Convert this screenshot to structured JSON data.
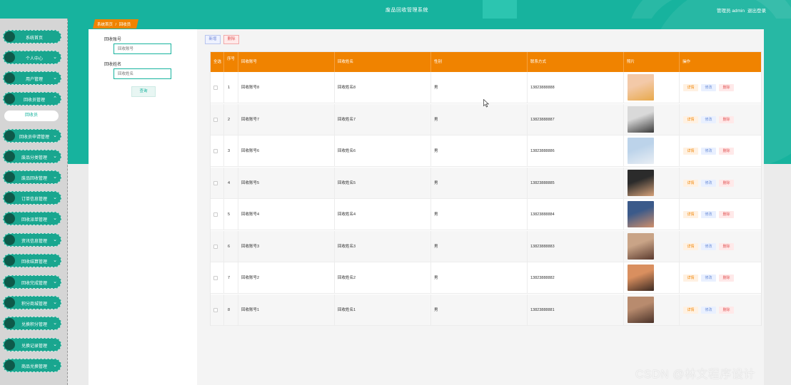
{
  "header": {
    "title": "废品回收管理系统",
    "admin_label": "管理员 admin",
    "logout_label": "退出登录"
  },
  "sidebar": {
    "items": [
      {
        "label": "系统首页",
        "expandable": false
      },
      {
        "label": "个人中心",
        "expandable": true
      },
      {
        "label": "用户管理",
        "expandable": true
      },
      {
        "label": "回收员管理",
        "expandable": true,
        "expanded": true
      },
      {
        "label": "回收员申请管理",
        "expandable": true
      },
      {
        "label": "废品分类管理",
        "expandable": true
      },
      {
        "label": "废品回收管理",
        "expandable": true
      },
      {
        "label": "订单信息管理",
        "expandable": true
      },
      {
        "label": "回收派单管理",
        "expandable": true
      },
      {
        "label": "资讯信息管理",
        "expandable": true
      },
      {
        "label": "回收结算管理",
        "expandable": true
      },
      {
        "label": "回收完成管理",
        "expandable": true
      },
      {
        "label": "积分商城管理",
        "expandable": true
      },
      {
        "label": "兑换积分管理",
        "expandable": true
      },
      {
        "label": "兑换记录管理",
        "expandable": true
      },
      {
        "label": "商品兑换管理",
        "expandable": true
      }
    ],
    "active_sub": "回收员"
  },
  "breadcrumb": {
    "home": "系统首页",
    "sep": "/",
    "current": "回收员"
  },
  "search": {
    "account_label": "回收账号",
    "account_placeholder": "回收账号",
    "name_label": "回收姓名",
    "name_placeholder": "回收姓名",
    "button_label": "查询"
  },
  "toolbar": {
    "add_label": "新增",
    "delete_label": "删除"
  },
  "table": {
    "headers": {
      "select": "全选",
      "index": "序号",
      "account": "回收账号",
      "name": "回收姓名",
      "gender": "性别",
      "phone": "联系方式",
      "photo": "照片",
      "actions": "操作"
    },
    "action_labels": {
      "detail": "详情",
      "edit": "修改",
      "remove": "删除"
    },
    "rows": [
      {
        "index": "1",
        "account": "回收账号8",
        "name": "回收姓名8",
        "gender": "男",
        "phone": "13823888888",
        "photo_colors": [
          "#f3c9a8",
          "#e8a94b"
        ]
      },
      {
        "index": "2",
        "account": "回收账号7",
        "name": "回收姓名7",
        "gender": "男",
        "phone": "13823888887",
        "photo_colors": [
          "#d9d9d9",
          "#3a3a3a"
        ]
      },
      {
        "index": "3",
        "account": "回收账号6",
        "name": "回收姓名6",
        "gender": "男",
        "phone": "13823888886",
        "photo_colors": [
          "#bcd3ea",
          "#e9eef4"
        ]
      },
      {
        "index": "4",
        "account": "回收账号5",
        "name": "回收姓名5",
        "gender": "男",
        "phone": "13823888885",
        "photo_colors": [
          "#2b2b2b",
          "#d6a27a"
        ]
      },
      {
        "index": "5",
        "account": "回收账号4",
        "name": "回收姓名4",
        "gender": "男",
        "phone": "13823888884",
        "photo_colors": [
          "#3b5a8a",
          "#d08f6b"
        ]
      },
      {
        "index": "6",
        "account": "回收账号3",
        "name": "回收姓名3",
        "gender": "男",
        "phone": "13823888883",
        "photo_colors": [
          "#c9a487",
          "#5b3a2e"
        ]
      },
      {
        "index": "7",
        "account": "回收账号2",
        "name": "回收姓名2",
        "gender": "男",
        "phone": "13823888882",
        "photo_colors": [
          "#d98f5f",
          "#3c2a22"
        ]
      },
      {
        "index": "8",
        "account": "回收账号1",
        "name": "回收姓名1",
        "gender": "男",
        "phone": "13823888881",
        "photo_colors": [
          "#b88b6e",
          "#4a3228"
        ]
      }
    ]
  },
  "watermark": "CSDN @林文程序设计",
  "colors": {
    "primary": "#17b39e",
    "header_orange": "#f08300",
    "delete_red": "#e25858",
    "edit_blue": "#6d8fd8"
  }
}
